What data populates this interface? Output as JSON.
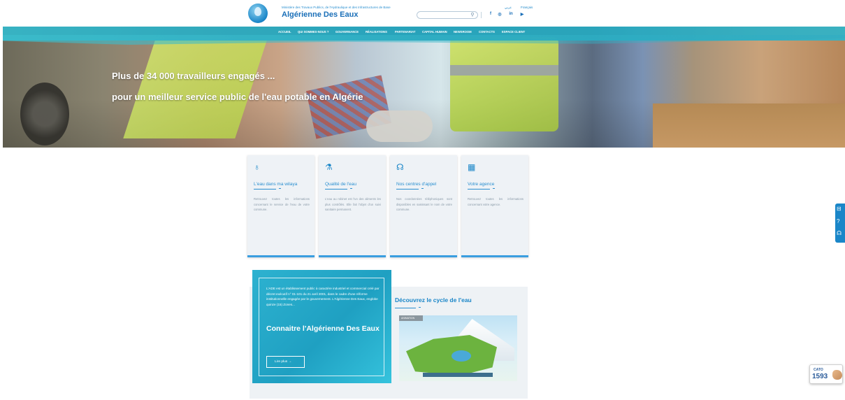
{
  "header": {
    "ministry_line": "Ministère des Travaux Publics, de l'Hydraulique et des Infrastructures de Base",
    "brand_name": "Algérienne Des Eaux",
    "search_placeholder": "",
    "languages": [
      "عربي",
      "Français"
    ],
    "social_icons": [
      "facebook-icon",
      "instagram-icon",
      "linkedin-icon",
      "youtube-icon"
    ]
  },
  "nav": {
    "items": [
      "ACCUEIL",
      "QUI SOMMES-NOUS ?",
      "GOUVERNANCE",
      "RÉALISATIONS",
      "PARTENARIAT",
      "CAPITAL HUMAIN",
      "NEWSROOM",
      "CONTACTS",
      "ESPACE CLIENT"
    ]
  },
  "hero": {
    "line1": "Plus de 34 000 travailleurs engagés ...",
    "line2": "pour un meilleur service public de l'eau potable en Algérie"
  },
  "cards": [
    {
      "icon": "water-drop-icon",
      "title": "L'eau dans ma wilaya",
      "text": "Retrouvez toutes les informations concernant le service de l'eau de votre commune."
    },
    {
      "icon": "microscope-icon",
      "title": "Qualité de l'eau",
      "text": "L'eau au robinet est l'un des aliments les plus contrôlés. Elle fait l'objet d'un suivi sanitaire permanent."
    },
    {
      "icon": "headset-icon",
      "title": "Nos centres d'appel",
      "text": "Nos coordonnées téléphoniques sont disponibles en saisissant le nom de votre commune."
    },
    {
      "icon": "building-icon",
      "title": "Votre agence",
      "text": "Retrouvez toutes les informations concernant votre agence."
    }
  ],
  "about": {
    "text": "L'ADE est un établissement public à caractère industriel et commercial créé par décret exécutif n° 01-101 du 21 avril 2001, dans le cadre d'une réforme institutionnelle engagée par le gouvernement. L'Algérienne Des Eaux, englobe quinze (15) Zones...",
    "title": "Connaitre l'Algérienne Des Eaux",
    "button": "Lire plus →"
  },
  "cycle": {
    "title": "Découvrez le cycle de l'eau",
    "image_tag": "ANIMATION"
  },
  "cato": {
    "label": "CATO",
    "number": "1593"
  },
  "colors": {
    "brand_blue": "#1a86c8",
    "teal": "#2db2d0",
    "card_bg": "#eef2f6"
  }
}
